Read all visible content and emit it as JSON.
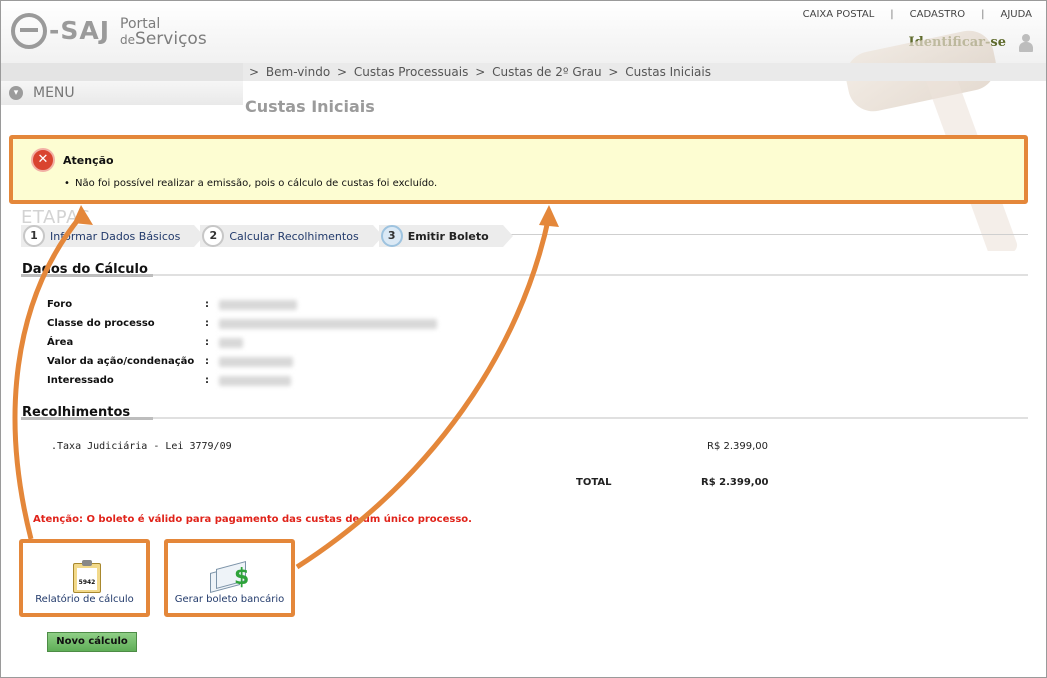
{
  "header": {
    "logo_main": "SAJ",
    "logo_portal_line1": "Portal",
    "logo_portal_de": "de",
    "logo_portal_servicos": "Serviços",
    "top_links": [
      "CAIXA POSTAL",
      "CADASTRO",
      "AJUDA"
    ],
    "separator": "|",
    "identify": "Identificar-se"
  },
  "breadcrumb": [
    ">",
    "Bem-vindo",
    ">",
    "Custas Processuais",
    ">",
    "Custas de 2º Grau",
    ">",
    "Custas Iniciais"
  ],
  "menu": {
    "label": "MENU"
  },
  "page_title": "Custas Iniciais",
  "alert": {
    "title": "Atenção",
    "message": "Não foi possível realizar a emissão, pois o cálculo de custas foi excluído."
  },
  "etapas": {
    "heading": "ETAPAS",
    "steps": [
      {
        "num": "1",
        "label": "Informar Dados Básicos"
      },
      {
        "num": "2",
        "label": "Calcular Recolhimentos"
      },
      {
        "num": "3",
        "label": "Emitir Boleto"
      }
    ]
  },
  "dados": {
    "title": "Dados do Cálculo",
    "fields": [
      {
        "label": "Foro",
        "colon": ":"
      },
      {
        "label": "Classe do processo",
        "colon": ":"
      },
      {
        "label": "Área",
        "colon": ":"
      },
      {
        "label": "Valor da ação/condenação",
        "colon": ":"
      },
      {
        "label": "Interessado",
        "colon": ":"
      }
    ]
  },
  "recolhimentos": {
    "title": "Recolhimentos",
    "items": [
      {
        "name": ".Taxa Judiciária - Lei 3779/09",
        "value": "R$ 2.399,00"
      }
    ],
    "total_label": "TOTAL",
    "total_value": "R$ 2.399,00"
  },
  "warning": "Atenção: O boleto é válido para pagamento das custas de um único processo.",
  "actions": {
    "relatorio": {
      "label": "Relatório de cálculo",
      "icon_text": "5942"
    },
    "boleto": {
      "label": "Gerar boleto bancário",
      "icon_text": "$"
    }
  },
  "buttons": {
    "novo_calculo": "Novo cálculo"
  },
  "colors": {
    "highlight": "#e4873a",
    "alert_bg": "#fdfdd2",
    "warning_red": "#e0231a",
    "button_green": "#6cb963"
  }
}
